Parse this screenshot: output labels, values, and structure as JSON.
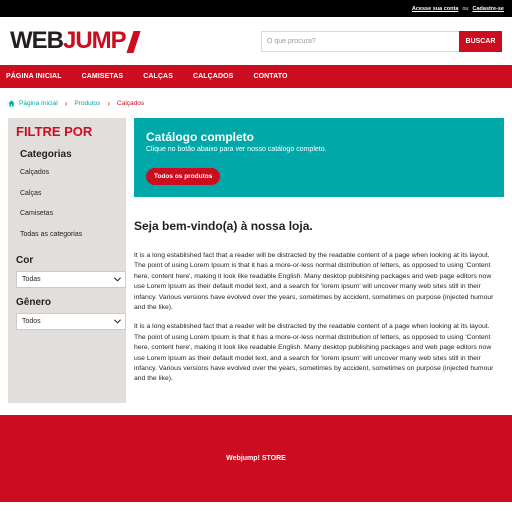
{
  "topbar": {
    "login_label": "Acesse sua conta",
    "or_label": "ou",
    "signup_label": "Cadastre-se"
  },
  "header": {
    "logo_text_dark": "WEB",
    "logo_text_red": "JUMP",
    "search": {
      "placeholder": "O que procura?",
      "button_label": "BUSCAR"
    }
  },
  "nav": {
    "items": [
      "PÁGINA INICIAL",
      "CAMISETAS",
      "CALÇAS",
      "CALÇADOS",
      "CONTATO"
    ]
  },
  "breadcrumb": {
    "items": [
      "Página Inicial",
      "Produtos",
      "Calçados"
    ],
    "icon": "home-icon"
  },
  "sidebar": {
    "title": "FILTRE POR",
    "categories_title": "Categorias",
    "categories": [
      "Calçados",
      "Calças",
      "Camisetas",
      "Todas as categorias"
    ],
    "color_title": "Cor",
    "color_selected": "Todas",
    "gender_title": "Gênero",
    "gender_selected": "Todos"
  },
  "banner": {
    "title": "Catálogo completo",
    "text": "Clique no botão abaixo para ver nosso catálogo completo.",
    "button_label": "Todos os produtos"
  },
  "main": {
    "welcome": "Seja bem-vindo(a) à nossa loja.",
    "paragraphs": [
      "It is a long established fact that a reader will be distracted by the readable content of a page when looking at its layout. The point of using Lorem Ipsum is that it has a more-or-less normal distribution of letters, as opposed to using 'Content here, content here', making it look like readable English. Many desktop publishing packages and web page editors now use Lorem Ipsum as their default model text, and a search for 'lorem ipsum' will uncover many web sites still in their infancy. Various versions have evolved over the years, sometimes by accident, sometimes on purpose (injected humour and the like).",
      "It is a long established fact that a reader will be distracted by the readable content of a page when looking at its layout. The point of using Lorem Ipsum is that it has a more-or-less normal distribution of letters, as opposed to using 'Content here, content here', making it look like readable English. Many desktop publishing packages and web page editors now use Lorem Ipsum as their default model text, and a search for 'lorem ipsum' will uncover many web sites still in their infancy. Various versions have evolved over the years, sometimes by accident, sometimes on purpose (injected humour and the like)."
    ]
  },
  "footer": {
    "text": "Webjump! STORE"
  },
  "colors": {
    "brand_red": "#cc0d1f",
    "teal": "#00a8a9",
    "dark": "#231f20",
    "sidebar_bg": "#e2dedc"
  }
}
